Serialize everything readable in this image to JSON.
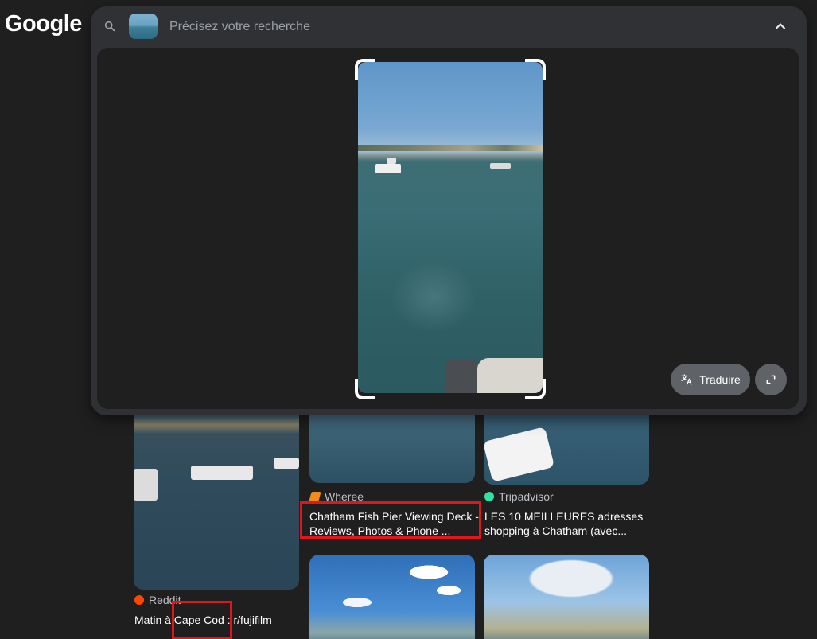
{
  "header": {
    "logo_text": "Google"
  },
  "search": {
    "placeholder": "Précisez votre recherche",
    "value": ""
  },
  "lens": {
    "translate_label": "Traduire",
    "translate_icon": "translate-icon",
    "expand_icon": "expand-icon"
  },
  "results": [
    {
      "source": "Reddit",
      "title": "Matin à Cape Cod : r/fujifilm",
      "source_color": "#ff4500"
    },
    {
      "source": "Wheree",
      "title": "Chatham Fish Pier Viewing Deck - Reviews, Photos & Phone ...",
      "source_color": "#f28b1a"
    },
    {
      "source": "Tripadvisor",
      "title": "LES 10 MEILLEURES adresses shopping à Chatham (avec...",
      "source_color": "#34e0a1"
    }
  ],
  "colors": {
    "highlight": "#e0161b",
    "panel": "#303134",
    "background": "#1f1f1f"
  }
}
